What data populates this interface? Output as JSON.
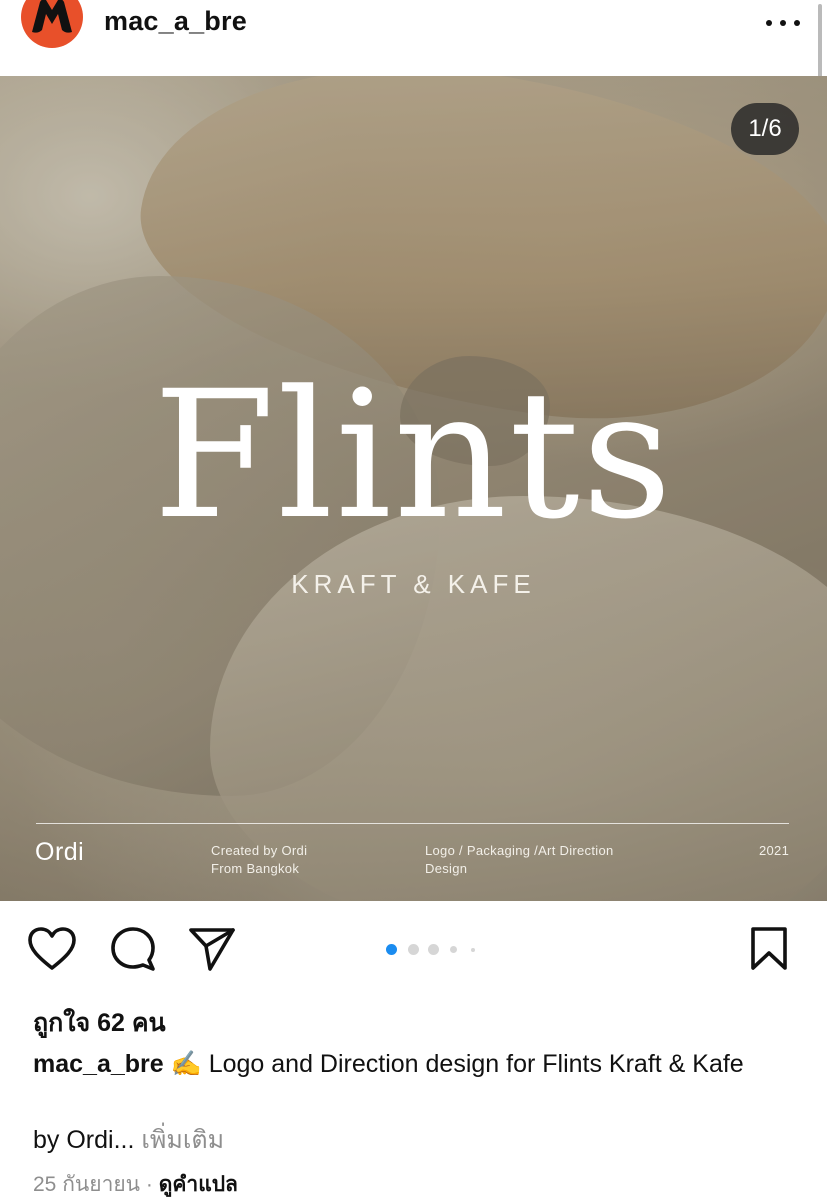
{
  "header": {
    "username": "mac_a_bre",
    "more_icon": "more-horizontal-icon"
  },
  "post": {
    "counter": "1/6",
    "title": "Flints",
    "subtitle": "KRAFT & KAFE",
    "brand": "Ordi",
    "meta": {
      "created_line1": "Created by Ordi",
      "created_line2": "From Bangkok",
      "services_line1": "Logo / Packaging /Art Direction",
      "services_line2": "Design",
      "year": "2021"
    },
    "carousel": {
      "total": 6,
      "active_index": 0,
      "active_color": "#1a8cf0"
    }
  },
  "actions": {
    "like_icon": "heart-icon",
    "comment_icon": "comment-icon",
    "share_icon": "send-icon",
    "save_icon": "bookmark-icon"
  },
  "likes_text": "ถูกใจ 62 คน",
  "caption": {
    "username": "mac_a_bre",
    "emoji": "✍️",
    "text": " Logo and Direction design for Flints Kraft & Kafe",
    "line2": "by Ordi...",
    "more_label": "เพิ่มเติม"
  },
  "footer": {
    "date": "25 กันยายน",
    "separator": "·",
    "translate_label": "ดูคำแปล"
  },
  "colors": {
    "avatar_bg": "#e8502a",
    "secondary_text": "#8e8e8e",
    "dot_active": "#1a8cf0",
    "dot_inactive": "#d6d6d6"
  }
}
